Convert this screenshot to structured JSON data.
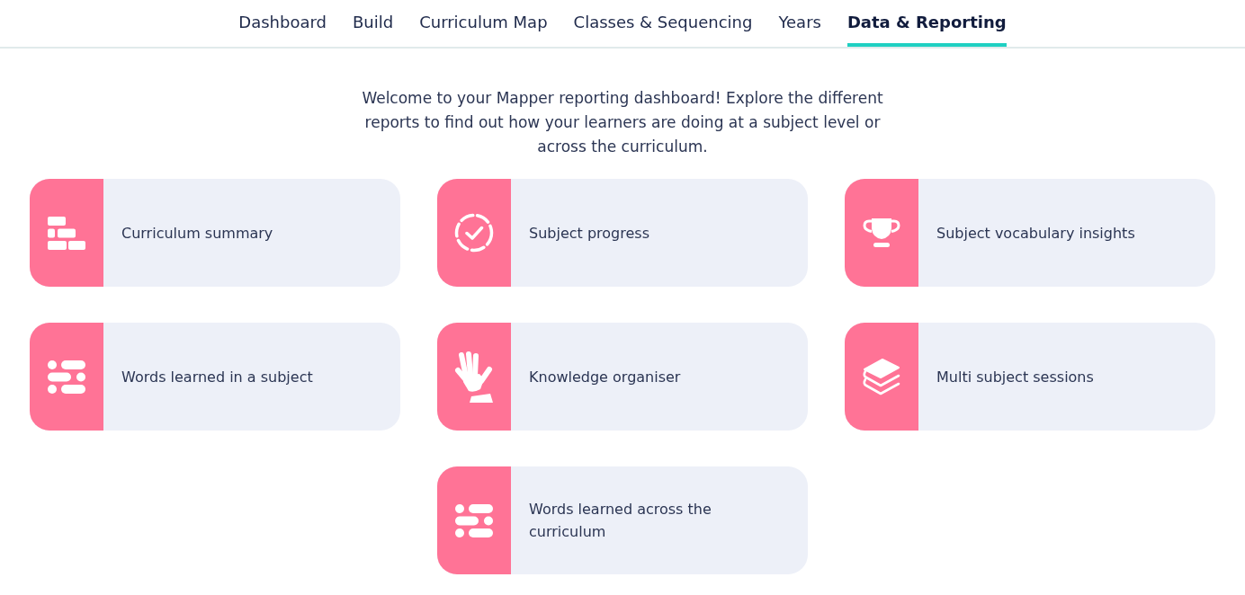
{
  "nav": {
    "tabs": [
      {
        "label": "Dashboard",
        "selected": false
      },
      {
        "label": "Build",
        "selected": false
      },
      {
        "label": "Curriculum Map",
        "selected": false
      },
      {
        "label": "Classes & Sequencing",
        "selected": false
      },
      {
        "label": "Years",
        "selected": false
      },
      {
        "label": "Data & Reporting",
        "selected": true
      }
    ]
  },
  "intro": "Welcome to your Mapper reporting dashboard! Explore the different reports to find out how your learners are doing at a subject level or across the curriculum.",
  "reports": [
    {
      "label": "Curriculum summary"
    },
    {
      "label": "Subject progress"
    },
    {
      "label": "Subject vocabulary insights"
    },
    {
      "label": "Words learned in a subject"
    },
    {
      "label": "Knowledge organiser"
    },
    {
      "label": "Multi subject sessions"
    },
    {
      "label": "Words learned across the curriculum"
    }
  ]
}
